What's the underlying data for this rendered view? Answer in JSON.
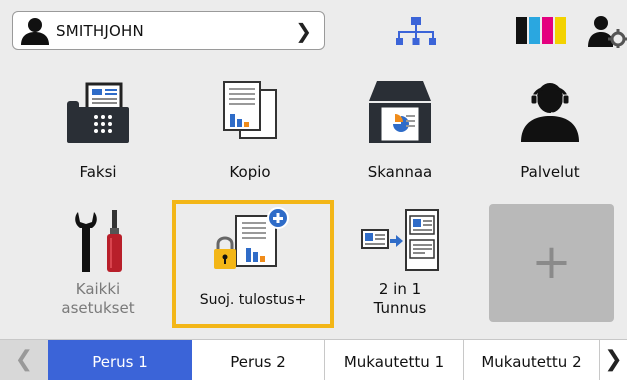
{
  "header": {
    "user_name": "SMITHJOHN",
    "toner_colors": [
      "#111111",
      "#2aa7e0",
      "#e4007f",
      "#f3d200"
    ]
  },
  "tiles": {
    "faksi": "Faksi",
    "kopio": "Kopio",
    "skannaa": "Skannaa",
    "palvelut": "Palvelut",
    "asetukset_line1": "Kaikki",
    "asetukset_line2": "asetukset",
    "suoj": "Suoj. tulostus+",
    "twoin1_line1": "2 in 1",
    "twoin1_line2": "Tunnus",
    "add_symbol": "+"
  },
  "tabs": {
    "tab1": "Perus 1",
    "tab2": "Perus 2",
    "tab3": "Mukautettu 1",
    "tab4": "Mukautettu 2",
    "active": "Perus 1"
  },
  "colors": {
    "accent_highlight": "#f3b617",
    "active_tab": "#3b64d8"
  }
}
